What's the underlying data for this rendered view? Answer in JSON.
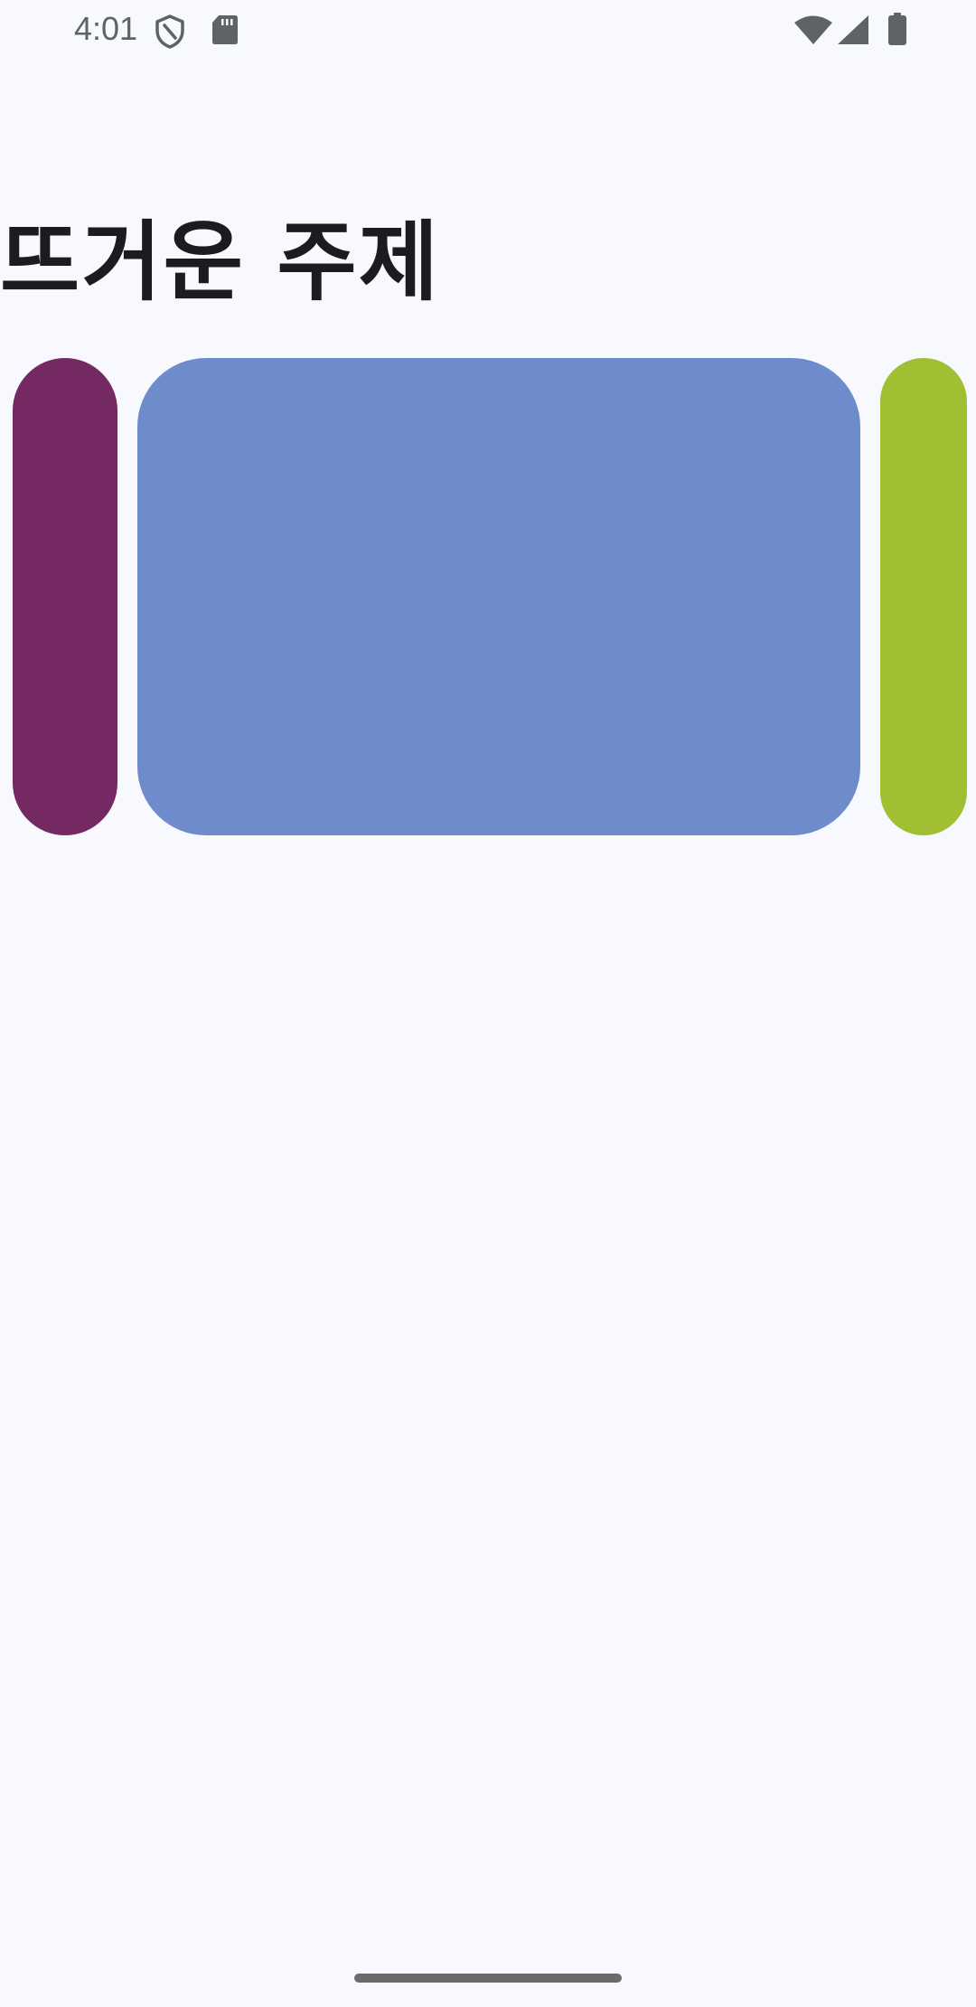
{
  "status_bar": {
    "time": "4:01",
    "icons": [
      "shield-icon",
      "sd-card-icon",
      "wifi-icon",
      "cellular-signal-icon",
      "battery-icon"
    ],
    "icon_color": "#5f6368"
  },
  "page": {
    "title": "뜨거운 주제",
    "background_color": "#f7f9fe",
    "title_color": "#1b1c20"
  },
  "carousel": {
    "items": [
      {
        "name": "item-previous",
        "color": "#752963"
      },
      {
        "name": "item-current",
        "color": "#6e8bcb"
      },
      {
        "name": "item-next",
        "color": "#a1bf32"
      }
    ]
  },
  "nav": {
    "handle_color": "#6b6b6b"
  }
}
